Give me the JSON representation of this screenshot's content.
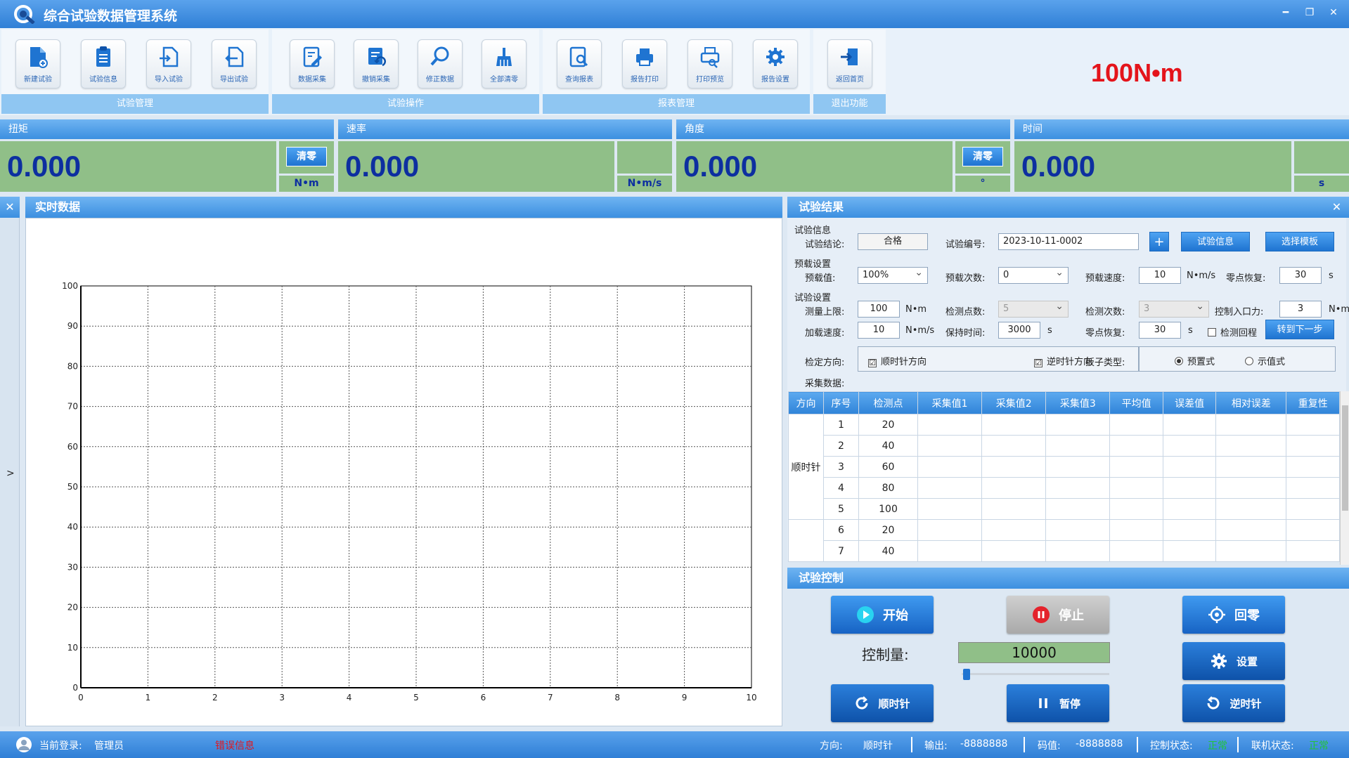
{
  "app": {
    "title": "综合试验数据管理系统",
    "big_torque": "100N•m"
  },
  "ribbon": {
    "groups": [
      {
        "label": "试验管理",
        "buttons": [
          "新建试验",
          "试验信息",
          "导入试验",
          "导出试验"
        ]
      },
      {
        "label": "试验操作",
        "buttons": [
          "数据采集",
          "撤销采集",
          "修正数据",
          "全部清零"
        ]
      },
      {
        "label": "报表管理",
        "buttons": [
          "查询报表",
          "报告打印",
          "打印预览",
          "报告设置"
        ]
      },
      {
        "label": "退出功能",
        "buttons": [
          "返回首页"
        ]
      }
    ]
  },
  "panels": [
    {
      "title": "扭矩",
      "value": "0.000",
      "button": "清零",
      "unit": "N•m"
    },
    {
      "title": "速率",
      "value": "0.000",
      "button": "",
      "unit": "N•m/s"
    },
    {
      "title": "角度",
      "value": "0.000",
      "button": "清零",
      "unit": "°"
    },
    {
      "title": "时间",
      "value": "0.000",
      "button": "",
      "unit": "s"
    }
  ],
  "realtime": {
    "title": "实时数据",
    "side_arrow": ">",
    "close": "✕"
  },
  "chart_data": {
    "type": "line",
    "x_ticks": [
      "0",
      "1",
      "2",
      "3",
      "4",
      "5",
      "6",
      "7",
      "8",
      "9",
      "10"
    ],
    "y_ticks": [
      "0",
      "10",
      "20",
      "30",
      "40",
      "50",
      "60",
      "70",
      "80",
      "90",
      "100"
    ],
    "xlim": [
      0,
      10
    ],
    "ylim": [
      0,
      100
    ],
    "grid": true,
    "series": []
  },
  "results": {
    "title": "试验结果",
    "close": "✕",
    "info": {
      "section": "试验信息",
      "conclusion_label": "试验结论:",
      "conclusion": "合格",
      "number_label": "试验编号:",
      "number": "2023-10-11-0002",
      "plus": "+",
      "info_button": "试验信息",
      "template_button": "选择模板"
    },
    "preload": {
      "section": "预载设置",
      "value_label": "预载值:",
      "value": "100%",
      "count_label": "预载次数:",
      "count": "0",
      "speed_label": "预载速度:",
      "speed": "10",
      "speed_unit": "N•m/s",
      "zero_label": "零点恢复:",
      "zero": "30",
      "zero_unit": "s"
    },
    "test": {
      "section": "试验设置",
      "upper_label": "测量上限:",
      "upper": "100",
      "upper_unit": "N•m",
      "points_label": "检测点数:",
      "points": "5",
      "times_label": "检测次数:",
      "times": "3",
      "entry_label": "控制入口力:",
      "entry": "3",
      "entry_unit": "N•m",
      "accel_label": "加载速度:",
      "accel": "10",
      "accel_unit": "N•m/s",
      "hold_label": "保持时间:",
      "hold": "3000",
      "hold_unit": "s",
      "zero_label": "零点恢复:",
      "zero": "30",
      "zero_unit": "s",
      "return_label": "检测回程",
      "next_button": "转到下一步"
    },
    "direction": {
      "label": "检定方向:",
      "cw": "顺时针方向",
      "ccw": "逆时针方向",
      "check": "☑"
    },
    "wrench": {
      "label": "扳子类型:",
      "preset": "预置式",
      "indicating": "示值式"
    },
    "collect_label": "采集数据:",
    "table": {
      "headers": [
        "方向",
        "序号",
        "检测点",
        "采集值1",
        "采集值2",
        "采集值3",
        "平均值",
        "误差值",
        "相对误差",
        "重复性"
      ],
      "group": "顺时针",
      "rows": [
        {
          "seq": "1",
          "point": "20"
        },
        {
          "seq": "2",
          "point": "40"
        },
        {
          "seq": "3",
          "point": "60"
        },
        {
          "seq": "4",
          "point": "80"
        },
        {
          "seq": "5",
          "point": "100"
        },
        {
          "seq": "6",
          "point": "20"
        },
        {
          "seq": "7",
          "point": "40"
        }
      ]
    }
  },
  "control": {
    "title": "试验控制",
    "start": "开始",
    "stop": "停止",
    "home": "回零",
    "amount_label": "控制量:",
    "amount": "10000",
    "settings": "设置",
    "cw": "顺时针",
    "pause": "暂停",
    "ccw": "逆时针"
  },
  "status": {
    "login_label": "当前登录:",
    "login": "管理员",
    "error": "错误信息",
    "direction_label": "方向:",
    "direction": "顺时针",
    "output_label": "输出:",
    "output": "-8888888",
    "code_label": "码值:",
    "code": "-8888888",
    "control_label": "控制状态:",
    "control": "正常",
    "link_label": "联机状态:",
    "link": "正常",
    "ok_color": "#22c33a"
  }
}
